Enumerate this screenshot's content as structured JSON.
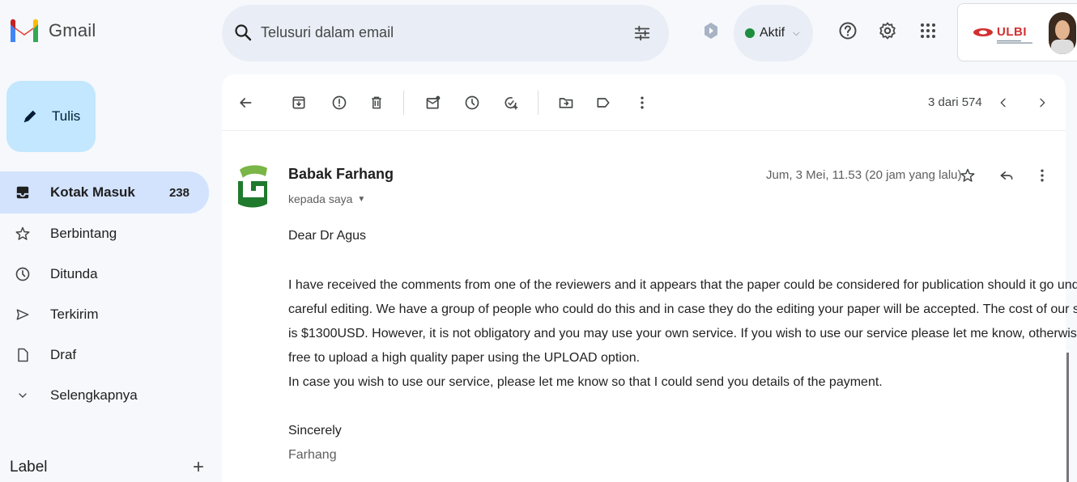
{
  "app": {
    "name": "Gmail"
  },
  "search": {
    "placeholder": "Telusuri dalam email"
  },
  "status": {
    "label": "Aktif",
    "color": "#1e8e3e"
  },
  "account": {
    "org_logo_text": "ULBI"
  },
  "compose": {
    "label": "Tulis"
  },
  "sidebar": {
    "items": [
      {
        "label": "Kotak Masuk",
        "count": "238",
        "icon": "inbox-icon",
        "active": true
      },
      {
        "label": "Berbintang",
        "icon": "star-icon"
      },
      {
        "label": "Ditunda",
        "icon": "clock-icon"
      },
      {
        "label": "Terkirim",
        "icon": "send-icon"
      },
      {
        "label": "Draf",
        "icon": "draft-icon"
      },
      {
        "label": "Selengkapnya",
        "icon": "chevron-down-icon"
      }
    ],
    "labels_heading": "Label"
  },
  "toolbar": {
    "icons": [
      "back-icon",
      "archive-icon",
      "report-spam-icon",
      "delete-icon",
      "mark-unread-icon",
      "snooze-icon",
      "add-task-icon",
      "move-to-icon",
      "label-icon",
      "more-icon"
    ],
    "pager_text": "3 dari 574"
  },
  "message": {
    "sender": "Babak Farhang",
    "to_line": "kepada saya",
    "date": "Jum, 3 Mei, 11.53 (20 jam yang lalu)",
    "greeting": "Dear Dr Agus",
    "para_lines": [
      "I have received the comments from one of the reviewers and it appears that the paper could be considered for publication should it go under",
      "careful editing. We have a group of people who could do this and in case they do the editing your paper will be accepted. The cost of our service",
      "is $1300USD. However, it is not obligatory and you may use your own service. If you wish to use our service please let me know, otherwise, feel",
      "free to upload a high quality paper using the UPLOAD option.",
      "In case you wish to use our service, please let me know so that I could send you details of the payment."
    ],
    "closing": "Sincerely",
    "signature": "Farhang"
  },
  "colors": {
    "accent": "#c2e7ff",
    "active_nav": "#d3e3fd",
    "background": "#f6f8fc",
    "search_bg": "#e9eef6"
  }
}
